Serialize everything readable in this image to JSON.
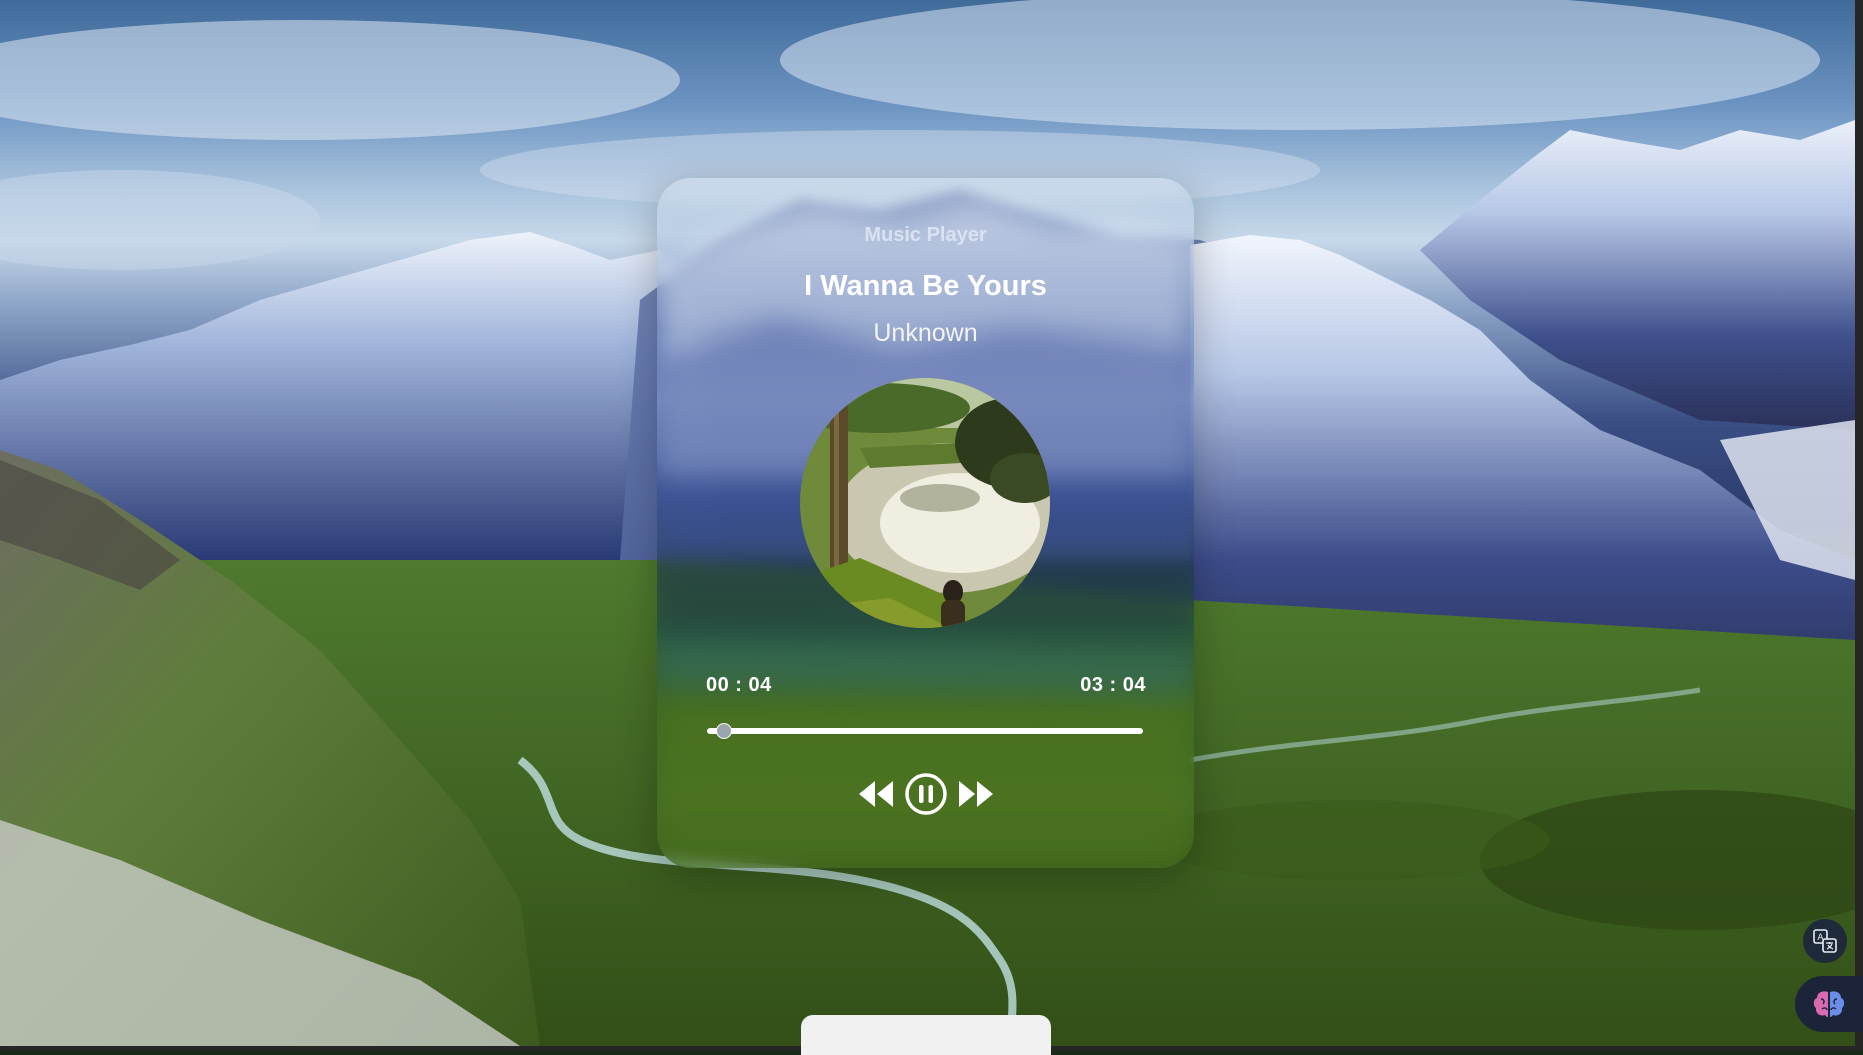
{
  "player": {
    "app_title": "Music Player",
    "song_title": "I Wanna Be Yours",
    "artist": "Unknown",
    "current_time": "00 : 04",
    "total_time": "03 : 04",
    "progress_fraction": 0.02
  },
  "controls": {
    "previous_icon": "rewind-icon",
    "play_pause_icon": "pause-icon",
    "next_icon": "fast-forward-icon"
  },
  "widgets": {
    "translate_icon": "translate-icon",
    "assistant_icon": "brain-icon"
  },
  "colors": {
    "accent": "#ffffff",
    "thumb": "#9aa5ad"
  }
}
